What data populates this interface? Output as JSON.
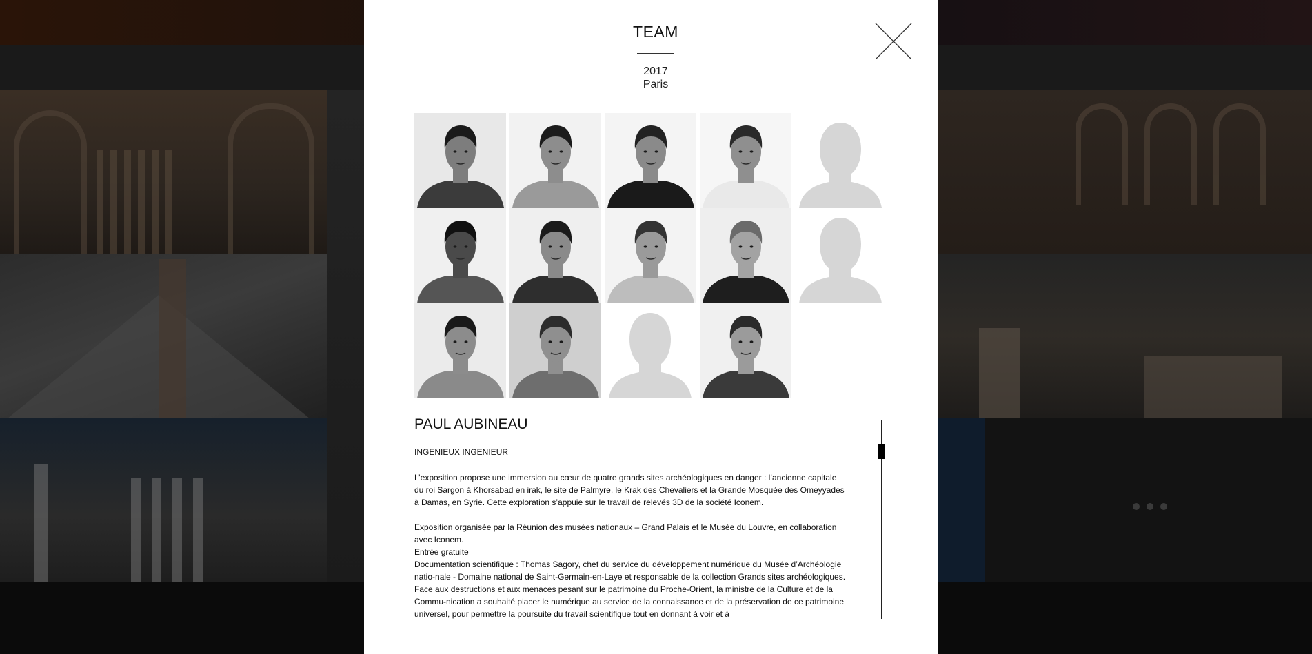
{
  "modal": {
    "title": "TEAM",
    "year": "2017",
    "city": "Paris",
    "close_icon": "close-icon"
  },
  "team": [
    {
      "kind": "photo",
      "tone": "#3b3b3b",
      "skin": "#7d7d7d",
      "hair": "#1a1a1a",
      "bg": "#e8e8e8"
    },
    {
      "kind": "photo",
      "tone": "#9a9a9a",
      "skin": "#8d8d8d",
      "hair": "#1c1c1c",
      "bg": "#f2f2f2"
    },
    {
      "kind": "photo",
      "tone": "#1a1a1a",
      "skin": "#8a8a8a",
      "hair": "#222222",
      "bg": "#f4f4f4"
    },
    {
      "kind": "photo",
      "tone": "#e9e9e9",
      "skin": "#8f8f8f",
      "hair": "#2a2a2a",
      "bg": "#f6f6f6"
    },
    {
      "kind": "placeholder"
    },
    {
      "kind": "photo",
      "tone": "#555555",
      "skin": "#4a4a4a",
      "hair": "#111111",
      "bg": "#f0f0f0"
    },
    {
      "kind": "photo",
      "tone": "#2e2e2e",
      "skin": "#8a8a8a",
      "hair": "#1a1a1a",
      "bg": "#efefef"
    },
    {
      "kind": "photo",
      "tone": "#bdbdbd",
      "skin": "#9a9a9a",
      "hair": "#333333",
      "bg": "#f3f3f3"
    },
    {
      "kind": "photo",
      "tone": "#1e1e1e",
      "skin": "#a3a3a3",
      "hair": "#6a6a6a",
      "bg": "#eeeeee"
    },
    {
      "kind": "placeholder"
    },
    {
      "kind": "photo",
      "tone": "#8a8a8a",
      "skin": "#8c8c8c",
      "hair": "#1a1a1a",
      "bg": "#ebebeb"
    },
    {
      "kind": "photo",
      "tone": "#6e6e6e",
      "skin": "#8f8f8f",
      "hair": "#2c2c2c",
      "bg": "#cfcfcf"
    },
    {
      "kind": "placeholder"
    },
    {
      "kind": "photo",
      "tone": "#3a3a3a",
      "skin": "#9b9b9b",
      "hair": "#2a2a2a",
      "bg": "#f0f0f0"
    }
  ],
  "person": {
    "name": "PAUL AUBINEAU",
    "role": "INGENIEUX INGENIEUR",
    "bio": [
      "L’exposition propose une immersion au cœur de quatre grands sites archéologiques en danger : l’ancienne capitale du roi Sargon à Khorsabad en irak, le site de Palmyre, le Krak des Chevaliers et la Grande Mosquée des Omeyyades à Damas, en Syrie. Cette exploration s’appuie sur le travail de relevés 3D de la société Iconem.",
      "Exposition organisée par la Réunion des musées nationaux – Grand Palais et le Musée du Louvre, en collaboration avec Iconem.",
      "Entrée gratuite",
      "Documentation scientifique : Thomas Sagory, chef du service du développement numérique du Musée d’Archéologie natio-nale - Domaine national de Saint-Germain-en-Laye et responsable de la collection Grands sites archéologiques.",
      "Face aux destructions et aux menaces pesant sur le patrimoine du Proche-Orient, la ministre de la Culture et de la Commu-nication a souhaité placer le numérique au service de la connaissance et de la préservation de ce patrimoine universel, pour permettre la poursuite du travail scientifique tout en donnant à voir et à"
    ]
  },
  "scroll": {
    "position": 0.13
  },
  "colors": {
    "modal_bg": "#ffffff",
    "overlay": "#000000",
    "placeholder": "#d6d6d6"
  }
}
